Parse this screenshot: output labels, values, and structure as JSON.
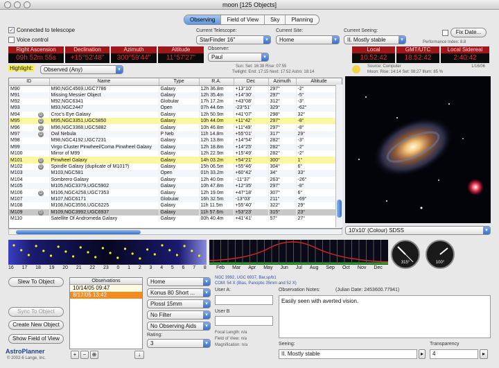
{
  "window": {
    "title": "moon [125 Objects]"
  },
  "tabs": [
    "Observing",
    "Field of View",
    "Sky",
    "Planning"
  ],
  "connection": {
    "connected_label": "Connected to telescope",
    "voice_label": "Voice control"
  },
  "telescope": {
    "label": "Current Telescope:",
    "value": "StarFinder 16\""
  },
  "site": {
    "label": "Current Site:",
    "value": "Home"
  },
  "seeing_top": {
    "label": "Current Seeing:",
    "value": "II. Mostly stable"
  },
  "fix_date_label": "Fix Date...",
  "performance_label": "Performance Index: 8.8",
  "readouts": [
    {
      "label": "Right Ascension",
      "value": "09h 52m 55s"
    },
    {
      "label": "Declination",
      "value": "+15°52'48\""
    },
    {
      "label": "Azimuth",
      "value": "300°59'44\""
    },
    {
      "label": "Altitude",
      "value": "11°57'27\""
    }
  ],
  "time_readouts": [
    {
      "label": "Local",
      "value": "10:52:42"
    },
    {
      "label": "GMT/UTC",
      "value": "18:52:42"
    },
    {
      "label": "Local Sidereal",
      "value": "2:40:42"
    }
  ],
  "observer": {
    "label": "Observer:",
    "value": "Paul"
  },
  "sun_line": "Sun: Set: 16:38 Rise: 07:55",
  "twilight_line": "Twilight: End: 17:15 Next: 17:52 Astro: 18:14",
  "date_line": "1/16/06",
  "source_line": "Source: Computer",
  "moon_line": "Moon: Rise: 14:14 Set: 08:27 Illum: 85 %",
  "highlight": {
    "label": "Highlight:",
    "value": "Observed (Any)"
  },
  "table": {
    "columns": [
      "ID",
      "Name",
      "Type",
      "R.A.",
      "Dec",
      "Azimuth",
      "Altitude"
    ],
    "rows": [
      {
        "id": "M90",
        "d": false,
        "name": "M90,NGC4569,UGC7786",
        "type": "Galaxy",
        "ra": "12h 36.8m",
        "dec": "+13°10'",
        "az": "297°",
        "alt": "-2°",
        "style": ""
      },
      {
        "id": "M91",
        "d": false,
        "name": "Missing Messier Object",
        "type": "Galaxy",
        "ra": "12h 35.4m",
        "dec": "+14°30'",
        "az": "297°",
        "alt": "-5°",
        "style": ""
      },
      {
        "id": "M92",
        "d": false,
        "name": "M92,NGC6341",
        "type": "Globular",
        "ra": "17h 17.2m",
        "dec": "+43°08'",
        "az": "312°",
        "alt": "-3°",
        "style": ""
      },
      {
        "id": "M93",
        "d": false,
        "name": "M93,NGC2447",
        "type": "Open",
        "ra": "07h 44.6m",
        "dec": "-23°51'",
        "az": "329°",
        "alt": "-62°",
        "style": ""
      },
      {
        "id": "M94",
        "d": true,
        "name": "Croc's Eye Galaxy",
        "type": "Galaxy",
        "ra": "12h 50.9m",
        "dec": "+41°07'",
        "az": "298°",
        "alt": "32°",
        "style": ""
      },
      {
        "id": "M95",
        "d": true,
        "name": "M95,NGC3351,UGC5850",
        "type": "Galaxy",
        "ra": "10h 44.0m",
        "dec": "+11°42'",
        "az": "297°",
        "alt": "-8°",
        "style": "hl"
      },
      {
        "id": "M96",
        "d": true,
        "name": "M96,NGC3368,UGC5882",
        "type": "Galaxy",
        "ra": "10h 46.8m",
        "dec": "+11°49'",
        "az": "297°",
        "alt": "-8°",
        "style": ""
      },
      {
        "id": "M97",
        "d": true,
        "name": "Owl Nebula",
        "type": "P Neb",
        "ra": "11h 14.8m",
        "dec": "+55°01'",
        "az": "317°",
        "alt": "29°",
        "style": ""
      },
      {
        "id": "M98",
        "d": false,
        "name": "M98,NGC4192,UGC7231",
        "type": "Galaxy",
        "ra": "12h 13.8m",
        "dec": "+14°54'",
        "az": "282°",
        "alt": "-3°",
        "style": ""
      },
      {
        "id": "M99",
        "d": false,
        "name": "Virgo Cluster Pinwheel/Coma Pinwheel Galaxy",
        "type": "Galaxy",
        "ra": "12h 18.8m",
        "dec": "+14°25'",
        "az": "282°",
        "alt": "-2°",
        "style": ""
      },
      {
        "id": "M100",
        "d": false,
        "name": "Mirror of M99",
        "type": "Galaxy",
        "ra": "12h 22.9m",
        "dec": "+15°49'",
        "az": "282°",
        "alt": "-2°",
        "style": ""
      },
      {
        "id": "M101",
        "d": true,
        "name": "Pinwheel Galaxy",
        "type": "Galaxy",
        "ra": "14h 03.2m",
        "dec": "+54°21'",
        "az": "300°",
        "alt": "1°",
        "style": "hl"
      },
      {
        "id": "M102",
        "d": true,
        "name": "Spindle Galaxy (duplicate of M101?)",
        "type": "Galaxy",
        "ra": "15h 06.5m",
        "dec": "+55°46'",
        "az": "304°",
        "alt": "6°",
        "style": ""
      },
      {
        "id": "M103",
        "d": false,
        "name": "M103,NGC581",
        "type": "Open",
        "ra": "01h 33.2m",
        "dec": "+60°42'",
        "az": "34°",
        "alt": "33°",
        "style": ""
      },
      {
        "id": "M104",
        "d": false,
        "name": "Sombrero Galaxy",
        "type": "Galaxy",
        "ra": "12h 40.0m",
        "dec": "-11°37'",
        "az": "263°",
        "alt": "-26°",
        "style": ""
      },
      {
        "id": "M105",
        "d": false,
        "name": "M105,NGC3379,UGC5902",
        "type": "Galaxy",
        "ra": "10h 47.8m",
        "dec": "+12°35'",
        "az": "297°",
        "alt": "-8°",
        "style": ""
      },
      {
        "id": "M106",
        "d": true,
        "name": "M106,NGC4258,UGC7353",
        "type": "Galaxy",
        "ra": "12h 19.0m",
        "dec": "+47°18'",
        "az": "307°",
        "alt": "6°",
        "style": ""
      },
      {
        "id": "M107",
        "d": false,
        "name": "M107,NGC6171",
        "type": "Globular",
        "ra": "16h 32.5m",
        "dec": "-13°03'",
        "az": "211°",
        "alt": "-69°",
        "style": ""
      },
      {
        "id": "M108",
        "d": false,
        "name": "M108,NGC3556,UGC6225",
        "type": "Galaxy",
        "ra": "11h 11.5m",
        "dec": "+55°40'",
        "az": "322°",
        "alt": "29°",
        "style": ""
      },
      {
        "id": "M109",
        "d": true,
        "name": "M109,NGC3992,UGC6937",
        "type": "Galaxy",
        "ra": "11h 57.6m",
        "dec": "+53°23'",
        "az": "315°",
        "alt": "23°",
        "style": "sel"
      },
      {
        "id": "M110",
        "d": false,
        "name": "Satellite Of Andromeda Galaxy",
        "type": "Galaxy",
        "ra": "00h 40.4m",
        "dec": "+41°41'",
        "az": "57°",
        "alt": "27°",
        "style": ""
      }
    ]
  },
  "image_selector": {
    "value": "10'x10' (Colour) SDSS"
  },
  "timeline_hours": [
    "16",
    "17",
    "18",
    "19",
    "20",
    "21",
    "22",
    "23",
    "0",
    "1",
    "2",
    "3",
    "4",
    "5",
    "6",
    "7",
    "8"
  ],
  "months": [
    "Feb",
    "Mar",
    "Apr",
    "May",
    "Jun",
    "Jul",
    "Aug",
    "Sep",
    "Oct",
    "Nov",
    "Dec"
  ],
  "compass": [
    {
      "label": "N",
      "value": "315°"
    },
    {
      "label": "E",
      "value": "100°"
    }
  ],
  "buttons": {
    "slew": "Slew To Object",
    "sync": "Sync To Object",
    "create": "Create New Object",
    "fov": "Show Field of View"
  },
  "observations": {
    "header": "Observations",
    "rows": [
      {
        "text": "10/14/05  09:47",
        "selected": false
      },
      {
        "text": "8/17/05  13:42",
        "selected": true
      }
    ]
  },
  "equipment": [
    {
      "value": "Home"
    },
    {
      "value": "Konus 80 Short ..."
    },
    {
      "value": "Plossl 15mm"
    },
    {
      "value": "No Filter"
    },
    {
      "value": "No Observing Aids"
    }
  ],
  "rating": {
    "label": "Rating:",
    "value": "3"
  },
  "object_info": {
    "line1": "NGC 3992, UGC 6937, Bar,sp/b1",
    "line2": "COM: 54 X (Bias, Panoptic 35mm and 52 X)"
  },
  "user_fields": {
    "a": "User A:",
    "b": "User B"
  },
  "calc_lines": [
    "Focal Length:  n/a",
    "Field of View:  n/a",
    "Magnification:  n/a"
  ],
  "notes": {
    "label": "Observation Notes:",
    "julian": "(Julian Date: 2453600.77941)",
    "text": "Easily seen with averted vision."
  },
  "seeing_bottom": {
    "label": "Seeing:",
    "value": "II. Mostly stable"
  },
  "transparency": {
    "label": "Transparency",
    "value": "4"
  },
  "logo": {
    "name": "AstroPlanner",
    "copyright": "© 2002-6 Lange, Inc."
  },
  "colors": {
    "red_label_bg": "#a0161a",
    "readout_text": "#e03030",
    "highlight_row": "#fbf7a0",
    "selected_obs": "#f58a1f"
  }
}
